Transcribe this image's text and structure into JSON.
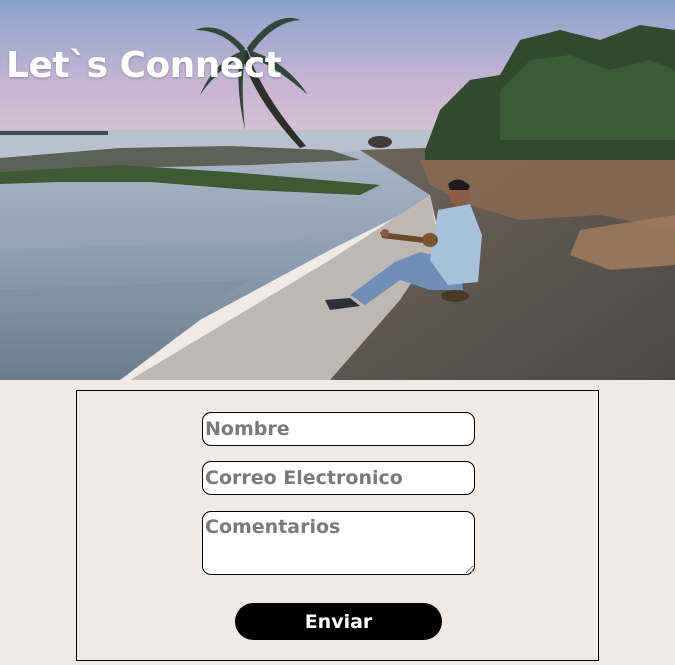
{
  "hero": {
    "title": "Let`s Connect"
  },
  "form": {
    "name_placeholder": "Nombre",
    "email_placeholder": "Correo Electronico",
    "comments_placeholder": "Comentarios",
    "submit_label": "Enviar"
  },
  "colors": {
    "page_background": "#efeae5",
    "button_background": "#000000",
    "button_text": "#ffffff",
    "placeholder_text": "#7a7a7a"
  }
}
